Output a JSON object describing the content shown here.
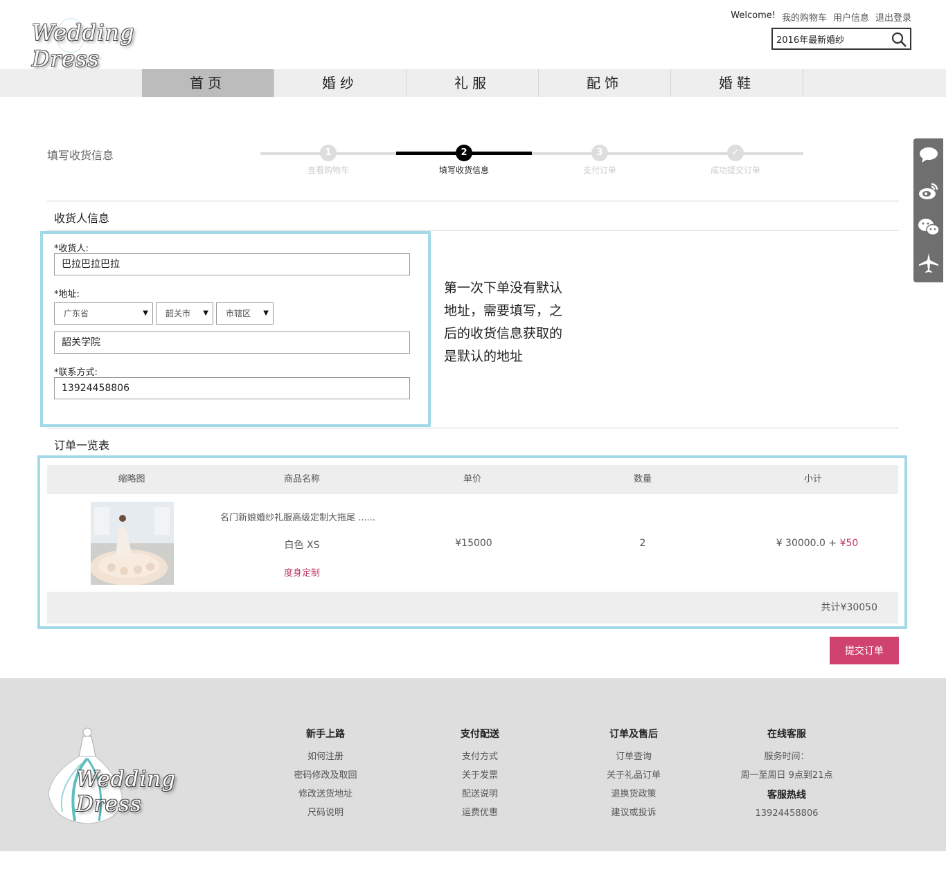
{
  "header": {
    "logo_text": "Wedding Dress",
    "links": [
      "Welcome!",
      "我的购物车",
      "用户信息",
      "退出登录"
    ],
    "search_value": "2016年最新婚纱"
  },
  "nav": {
    "items": [
      "首页",
      "婚纱",
      "礼服",
      "配饰",
      "婚鞋"
    ],
    "active_index": 0
  },
  "steps": {
    "page_heading": "填写收货信息",
    "items": [
      {
        "num": "1",
        "label": "查看购物车"
      },
      {
        "num": "2",
        "label": "填写收货信息"
      },
      {
        "num": "3",
        "label": "支付订单"
      },
      {
        "num": "✓",
        "label": "成功提交订单"
      }
    ],
    "active_index": 1
  },
  "receiver": {
    "section_title": "收货人信息",
    "name_label": "*收货人:",
    "name_value": "巴拉巴拉巴拉",
    "address_label": "*地址:",
    "province": "广东省",
    "city": "韶关市",
    "district": "市辖区",
    "address_detail": "韶关学院",
    "contact_label": "*联系方式:",
    "contact_value": "13924458806"
  },
  "note": "第一次下单没有默认地址，需要填写，之后的收货信息获取的是默认的地址",
  "order": {
    "section_title": "订单一览表",
    "headers": [
      "缩略图",
      "商品名称",
      "单价",
      "数量",
      "小计"
    ],
    "item": {
      "name": "名门新娘婚纱礼服高级定制大拖尾 ......",
      "spec": "白色 XS",
      "custom": "度身定制",
      "price": "¥15000",
      "qty": "2",
      "subtotal": "¥ 30000.0 +",
      "extra": "¥50"
    },
    "total": "共计¥30050",
    "submit_label": "提交订单"
  },
  "sidebar_icons": [
    "chat-icon",
    "weibo-icon",
    "wechat-icon",
    "airplane-icon"
  ],
  "footer": {
    "logo_text": "Wedding Dress",
    "columns": [
      {
        "title": "新手上路",
        "items": [
          "如何注册",
          "密码修改及取回",
          "修改送货地址",
          "尺码说明"
        ]
      },
      {
        "title": "支付配送",
        "items": [
          "支付方式",
          "关于发票",
          "配送说明",
          "运费优惠"
        ]
      },
      {
        "title": "订单及售后",
        "items": [
          "订单查询",
          "关于礼品订单",
          "退换货政策",
          "建议或投诉"
        ]
      }
    ],
    "service": {
      "title": "在线客服",
      "hours_label": "服务时间：",
      "hours": "周一至周日 9点到21点",
      "hotline_title": "客服热线",
      "hotline": "13924458806"
    }
  },
  "colors": {
    "accent": "#d0436e",
    "highlight_border": "#a2d9e6",
    "nav_bg": "#eeeeee",
    "footer_bg": "#dedede"
  }
}
